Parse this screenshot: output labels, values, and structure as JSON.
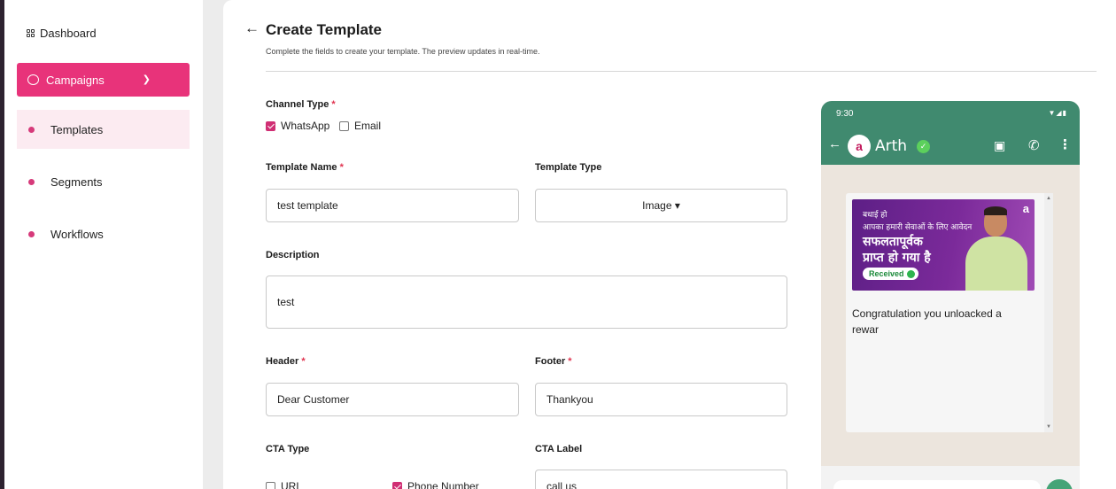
{
  "sidebar": {
    "dashboard": "Dashboard",
    "campaigns": "Campaigns",
    "items": [
      {
        "label": "Templates"
      },
      {
        "label": "Segments"
      },
      {
        "label": "Workflows"
      }
    ]
  },
  "header": {
    "title": "Create Template",
    "subtitle": "Complete the fields to create your template. The preview updates in real-time."
  },
  "form": {
    "channel_type_label": "Channel Type",
    "required_mark": "*",
    "channel_whatsapp": "WhatsApp",
    "channel_email": "Email",
    "template_name_label": "Template Name",
    "template_name_value": "test template",
    "template_type_label": "Template Type",
    "template_type_value": "Image ▾",
    "description_label": "Description",
    "description_value": "test",
    "header_label": "Header",
    "header_value": "Dear Customer",
    "footer_label": "Footer",
    "footer_value": "Thankyou",
    "cta_type_label": "CTA Type",
    "cta_url": "URL",
    "cta_phone": "Phone Number",
    "cta_label_label": "CTA Label",
    "cta_label_value": "call us"
  },
  "preview": {
    "time": "9:30",
    "status_icons": "▼◢▮",
    "contact_name": "Arth",
    "avatar_letter": "a",
    "banner_line1": "बधाई हो",
    "banner_line2": "आपका हमारी सेवाओं के लिए आवेदन",
    "banner_line3": "सफलतापूर्वक",
    "banner_line4": "प्राप्त हो गया है",
    "banner_badge": "Received",
    "banner_logo": "a",
    "message": "Congratulation you unloacked a rewar"
  },
  "colors": {
    "accent": "#e8337a",
    "whatsapp_header": "#408a6f",
    "chat_bg": "#ece5dd"
  }
}
